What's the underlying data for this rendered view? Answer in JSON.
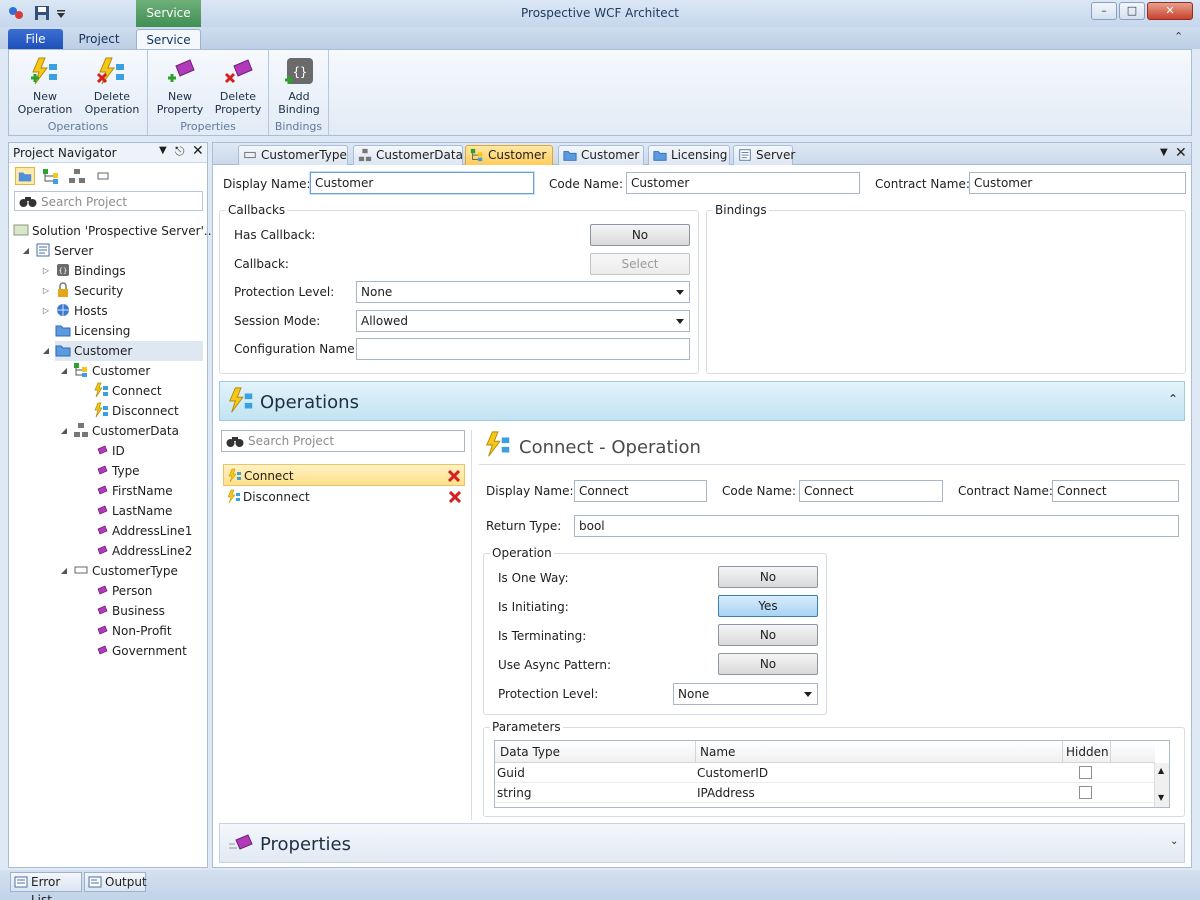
{
  "window": {
    "title": "Prospective WCF Architect"
  },
  "ribbon": {
    "context_header": "Service",
    "tabs": [
      "File",
      "Project",
      "Service"
    ],
    "groups": [
      {
        "label": "Operations",
        "buttons": [
          "New\nOperation",
          "Delete\nOperation"
        ]
      },
      {
        "label": "Properties",
        "buttons": [
          "New\nProperty",
          "Delete\nProperty"
        ]
      },
      {
        "label": "Bindings",
        "buttons": [
          "Add\nBinding"
        ]
      }
    ]
  },
  "navigator": {
    "title": "Project Navigator",
    "search_placeholder": "Search Project",
    "tree": [
      "Solution 'Prospective Server'...",
      "Server",
      "Bindings",
      "Security",
      "Hosts",
      "Licensing",
      "Customer",
      "Customer",
      "Connect",
      "Disconnect",
      "CustomerData",
      "ID",
      "Type",
      "FirstName",
      "LastName",
      "AddressLine1",
      "AddressLine2",
      "CustomerType",
      "Person",
      "Business",
      "Non-Profit",
      "Government"
    ]
  },
  "doc_tabs": [
    "CustomerType",
    "CustomerData",
    "Customer",
    "Customer",
    "Licensing",
    "Server"
  ],
  "service": {
    "display_name_label": "Display Name:",
    "display_name": "Customer",
    "code_name_label": "Code Name:",
    "code_name": "Customer",
    "contract_name_label": "Contract Name:",
    "contract_name": "Customer",
    "callbacks": {
      "title": "Callbacks",
      "has_callback_label": "Has Callback:",
      "has_callback": "No",
      "callback_label": "Callback:",
      "select_label": "Select",
      "protection_label": "Protection Level:",
      "protection": "None",
      "session_label": "Session Mode:",
      "session": "Allowed",
      "config_label": "Configuration Name:",
      "config": ""
    },
    "bindings_title": "Bindings"
  },
  "operations": {
    "header": "Operations",
    "search_placeholder": "Search Project",
    "items": [
      "Connect",
      "Disconnect"
    ],
    "detail": {
      "title": "Connect - Operation",
      "display_name_label": "Display Name:",
      "display_name": "Connect",
      "code_name_label": "Code Name:",
      "code_name": "Connect",
      "contract_name_label": "Contract Name:",
      "contract_name": "Connect",
      "return_type_label": "Return Type:",
      "return_type": "bool",
      "group_title": "Operation",
      "one_way_label": "Is One Way:",
      "one_way": "No",
      "initiating_label": "Is Initiating:",
      "initiating": "Yes",
      "terminating_label": "Is Terminating:",
      "terminating": "No",
      "async_label": "Use Async Pattern:",
      "async": "No",
      "protection_label": "Protection Level:",
      "protection": "None",
      "params_title": "Parameters",
      "param_headers": [
        "Data Type",
        "Name",
        "Hidden"
      ],
      "params": [
        {
          "type": "Guid",
          "name": "CustomerID"
        },
        {
          "type": "string",
          "name": "IPAddress"
        }
      ]
    }
  },
  "properties_header": "Properties",
  "status": {
    "tabs": [
      "Error List",
      "Output"
    ]
  }
}
